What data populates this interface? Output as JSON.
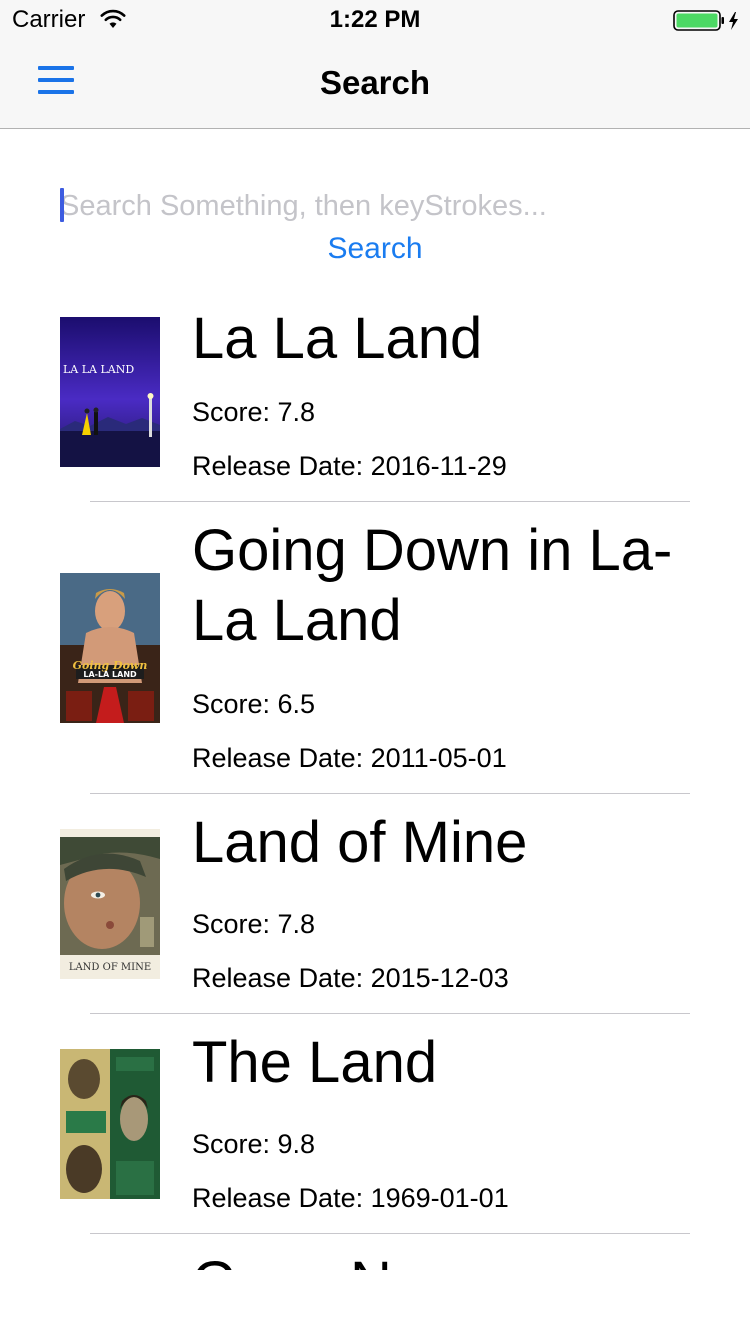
{
  "status_bar": {
    "carrier": "Carrier",
    "time": "1:22 PM"
  },
  "nav": {
    "title": "Search",
    "menu_icon": "hamburger-menu-icon"
  },
  "search": {
    "placeholder": "Search Something, then keyStrokes...",
    "value": "",
    "button_label": "Search"
  },
  "results": [
    {
      "title": "La La Land",
      "score": "Score: 7.8",
      "release": "Release Date: 2016-11-29",
      "poster_text": "LA LA LAND"
    },
    {
      "title": "Going Down in La-La Land",
      "score": "Score: 6.5",
      "release": "Release Date: 2011-05-01",
      "poster_text": "Going Down",
      "poster_sub": "LA-LA LAND"
    },
    {
      "title": "Land of Mine",
      "score": "Score: 7.8",
      "release": "Release Date: 2015-12-03",
      "poster_text": "LAND OF MINE"
    },
    {
      "title": "The Land",
      "score": "Score: 9.8",
      "release": "Release Date: 1969-01-01"
    },
    {
      "title": "Gone N"
    }
  ],
  "colors": {
    "accent": "#1a7cf0",
    "caret": "#3d5ce0",
    "battery": "#4cd964",
    "separator": "#c8c7cc",
    "bar_bg": "#f7f7f7"
  }
}
